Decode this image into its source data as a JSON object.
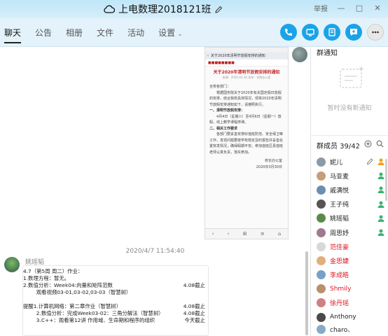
{
  "window": {
    "title": "上电数理2018121班",
    "controls": [
      "举报",
      "—",
      "□",
      "✕"
    ]
  },
  "tabs": [
    {
      "label": "聊天",
      "active": true
    },
    {
      "label": "公告",
      "active": false
    },
    {
      "label": "相册",
      "active": false
    },
    {
      "label": "文件",
      "active": false
    },
    {
      "label": "活动",
      "active": false
    },
    {
      "label": "设置",
      "active": false
    }
  ],
  "toolbar": {
    "phone_icon": "phone-icon",
    "screen_icon": "screen-share-icon",
    "doc_icon": "document-icon",
    "add_icon": "add-chat-icon",
    "more_icon": "more-icon"
  },
  "notice_screenshot": {
    "url_text": "关于2020年清明节放假安排的通知",
    "title": "关于2020年清明节放假安排的通知",
    "subtitle": "来源：2020-03-30 发布：学院办公室",
    "greeting": "全校各部门：",
    "para1": "根据国务院关于2020年有关国定假日放假的安排，结合我校具体情况，现将2020年清明节放假安排通知如下，请遵照执行。",
    "h1": "一、清明节放假安排：",
    "para2": "4月4日（星期六）至4月6日（星期一）放假，线上教学课程停课。",
    "h2": "二、相关工作要求",
    "para3": "各部门要妥善安排好值班防范、安全保卫等工作，发现问题要按学校规定及时报告并妥善处置突发情况，确保假期平安。参加值班区县值班老师认真负责，落实参加。",
    "sign": "校长办公室",
    "date": "2020年3月30日",
    "nav": [
      "‹",
      "›",
      "⊞",
      "≡",
      "⌂"
    ]
  },
  "timestamp": "2020/4/7 11:54:40",
  "message": {
    "sender": "姚瑶韬",
    "lines": [
      {
        "left": "4.7（第5周 周二）作业：",
        "right": ""
      },
      {
        "left": "1.数理方程：暂无。",
        "right": ""
      },
      {
        "left": "2.数值分析：Week04:向量和矩阵范数",
        "right": "4.08截止"
      },
      {
        "left": "        观看视频03-01,03-02,03-03（智慧树）",
        "right": ""
      },
      {
        "left": "",
        "right": ""
      },
      {
        "left": "提醒1.计算机网络：第二章作业（智慧树）",
        "right": "4.08截止"
      },
      {
        "left": "        2.数值分析：完成Week03-02：三角分解法（智慧树）",
        "right": "4.08截止"
      },
      {
        "left": "        3.C++：观看第12讲 作用域、生命期和程序的组织",
        "right": "今天截止"
      }
    ]
  },
  "sidebar": {
    "notice_title": "群通知",
    "notice_empty": "暂时没有新通知",
    "members_title": "群成员 39/42",
    "members": [
      {
        "name": "妮儿",
        "red": false,
        "color": "#8a9aa8",
        "role": "owner"
      },
      {
        "name": "马亚麦",
        "red": false,
        "color": "#c79e7a",
        "role": "admin"
      },
      {
        "name": "戚满悦",
        "red": false,
        "color": "#6a8fb0",
        "role": "admin"
      },
      {
        "name": "王子纯",
        "red": false,
        "color": "#555555",
        "role": "admin"
      },
      {
        "name": "姚瑶韬",
        "red": false,
        "color": "#5a8a4a",
        "role": "admin"
      },
      {
        "name": "周思妤",
        "red": false,
        "color": "#a07890",
        "role": "admin"
      },
      {
        "name": "范佳豪",
        "red": true,
        "color": "#d8d8d8",
        "role": ""
      },
      {
        "name": "金思婕",
        "red": true,
        "color": "#e0b07c",
        "role": ""
      },
      {
        "name": "李成皓",
        "red": true,
        "color": "#7aa0c8",
        "role": ""
      },
      {
        "name": "Shmily",
        "red": true,
        "color": "#b89070",
        "role": ""
      },
      {
        "name": "徐丹瑶",
        "red": true,
        "color": "#d08080",
        "role": ""
      },
      {
        "name": "Anthony",
        "red": false,
        "color": "#4a4a4a",
        "role": ""
      },
      {
        "name": "charo、",
        "red": false,
        "color": "#88aac8",
        "role": ""
      }
    ]
  },
  "colors": {
    "accent": "#1aa3e8",
    "titlebar": "#c4e7f8",
    "tabbar": "#e4f3fb",
    "red_name": "#e0141e",
    "notice_red": "#c0262b"
  }
}
